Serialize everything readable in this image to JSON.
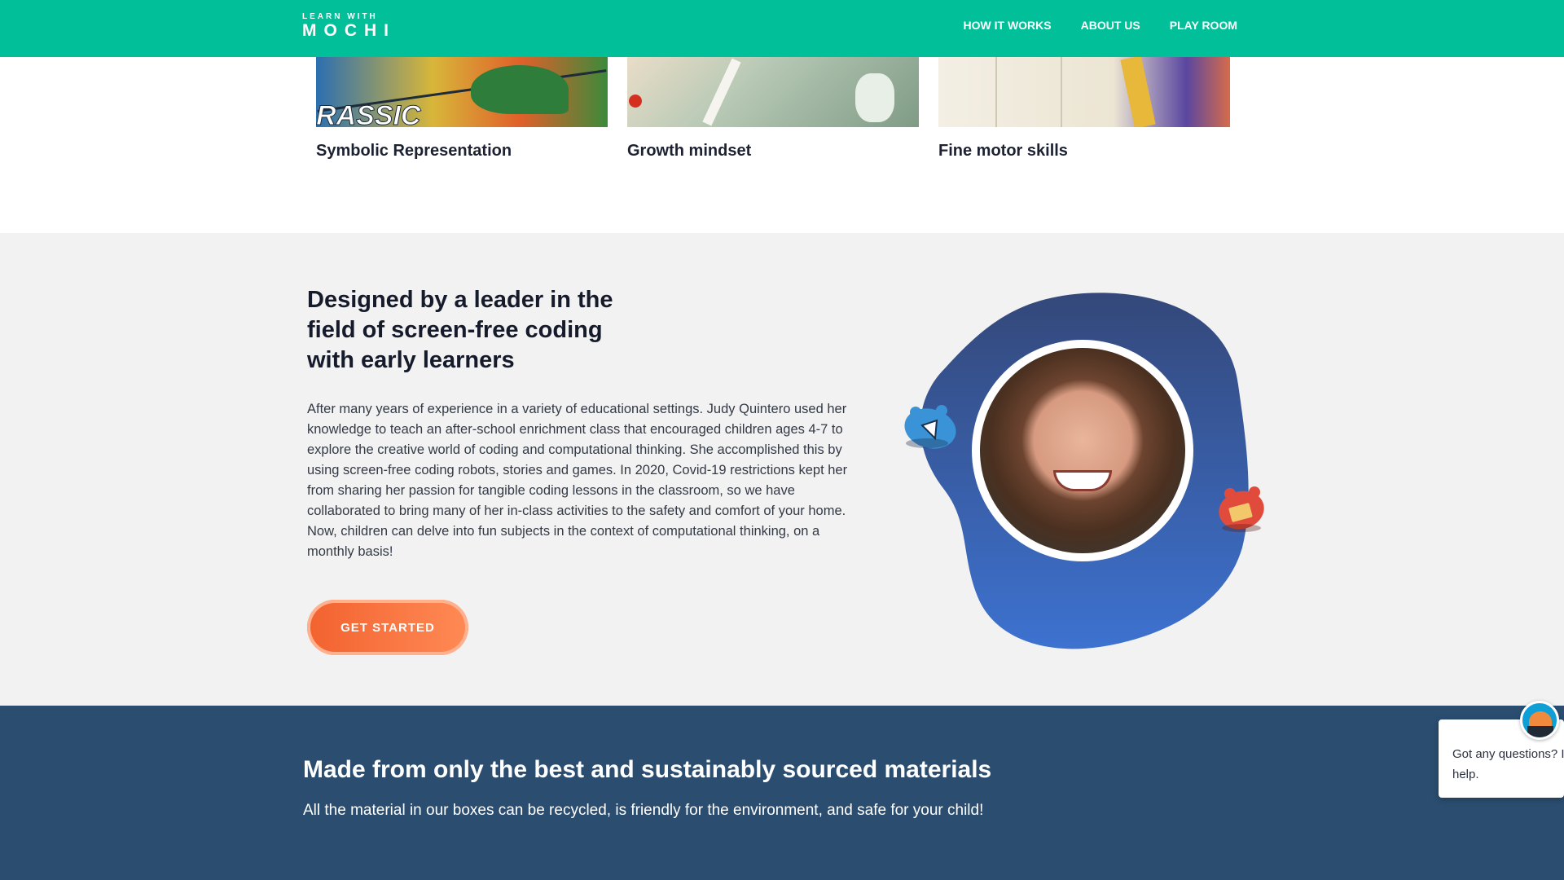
{
  "header": {
    "logo_top": "LEARN WITH",
    "logo_main": "MOCHI",
    "nav": [
      "HOW IT WORKS",
      "ABOUT US",
      "PLAY ROOM"
    ]
  },
  "cards": [
    {
      "title": "Symbolic Representation",
      "image_word": "RASSIC"
    },
    {
      "title": "Growth mindset"
    },
    {
      "title": "Fine motor skills"
    }
  ],
  "about": {
    "title": "Designed by a leader in the field of screen-free coding with early learners",
    "body": "After many years of experience in a variety of educational settings. Judy Quintero used her knowledge to teach an after-school enrichment class that encouraged children ages 4-7 to explore the creative world of coding and computational thinking. She accomplished this by using screen-free coding robots, stories and games. In 2020, Covid-19 restrictions kept her from sharing her passion for tangible coding lessons in the classroom, so we have collaborated to bring many of her in-class activities to the safety and comfort of your home. Now, children can delve into fun subjects in the context of computational thinking, on a monthly basis!",
    "cta_label": "GET STARTED"
  },
  "materials": {
    "title": "Made from only the best and sustainably sourced materials",
    "text": "All the material in our boxes can be recycled, is friendly for the environment, and safe for your child!"
  },
  "chat": {
    "message": "Got any questions? I' help."
  },
  "colors": {
    "header": "#00bf99",
    "cta": "#f2622f",
    "blob": "#3a62b8",
    "materials_bg": "#2b4d70"
  },
  "icons": [
    "mochi-logo",
    "blue-bear-mascot-icon",
    "red-bear-mascot-icon",
    "chat-avatar-icon"
  ]
}
